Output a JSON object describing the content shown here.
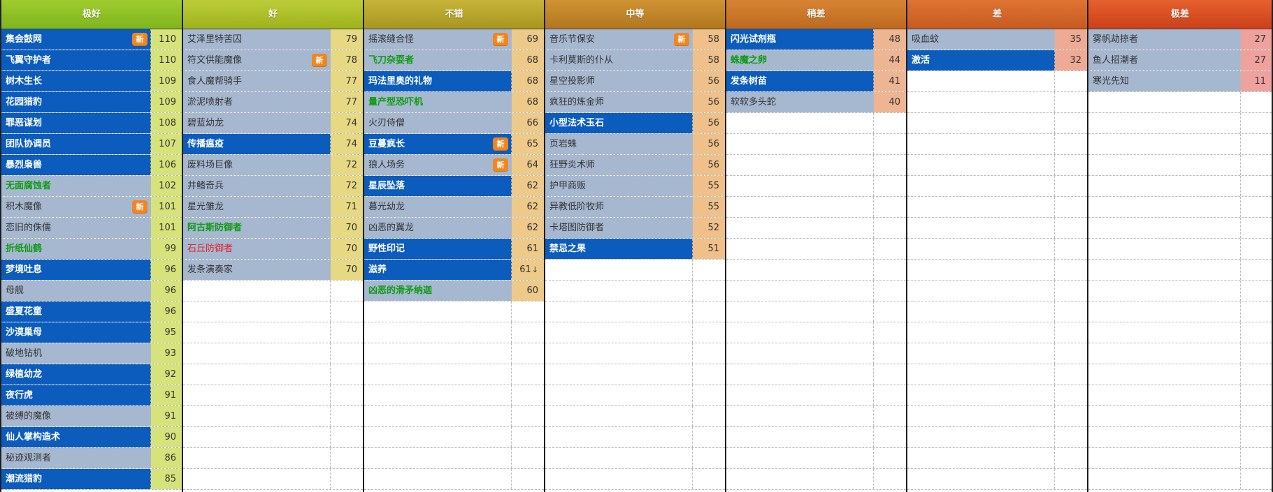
{
  "columns": [
    {
      "title": "极好",
      "header_color": "#7fb51d",
      "header_color_light": "#9fcc2f",
      "score_bg": "#d6e37b",
      "rows": [
        {
          "name": "集会鼓网",
          "score": "110",
          "style": "dark",
          "badge": "新"
        },
        {
          "name": "飞翼守护者",
          "score": "110",
          "style": "dark"
        },
        {
          "name": "树木生长",
          "score": "109",
          "style": "dark"
        },
        {
          "name": "花园猎豹",
          "score": "109",
          "style": "dark"
        },
        {
          "name": "罪恶谋划",
          "score": "108",
          "style": "dark"
        },
        {
          "name": "团队协调员",
          "score": "107",
          "style": "dark"
        },
        {
          "name": "暴烈枭兽",
          "score": "106",
          "style": "dark"
        },
        {
          "name": "无面腐蚀者",
          "score": "102",
          "style": "green"
        },
        {
          "name": "积木魔像",
          "score": "101",
          "style": "light",
          "badge": "新"
        },
        {
          "name": "恋旧的侏儒",
          "score": "101",
          "style": "light"
        },
        {
          "name": "折纸仙鹤",
          "score": "99",
          "style": "green"
        },
        {
          "name": "梦境吐息",
          "score": "96",
          "style": "dark"
        },
        {
          "name": "母舰",
          "score": "96",
          "style": "light"
        },
        {
          "name": "盛夏花童",
          "score": "96",
          "style": "dark"
        },
        {
          "name": "沙漠巢母",
          "score": "95",
          "style": "dark"
        },
        {
          "name": "破地钻机",
          "score": "93",
          "style": "light"
        },
        {
          "name": "绿植幼龙",
          "score": "92",
          "style": "dark"
        },
        {
          "name": "夜行虎",
          "score": "91",
          "style": "dark"
        },
        {
          "name": "被缚的魔像",
          "score": "91",
          "style": "light"
        },
        {
          "name": "仙人掌构造术",
          "score": "90",
          "style": "dark"
        },
        {
          "name": "秘迹观测者",
          "score": "86",
          "style": "light"
        },
        {
          "name": "潮流猎豹",
          "score": "85",
          "style": "dark"
        }
      ]
    },
    {
      "title": "好",
      "header_color": "#9eb21c",
      "header_color_light": "#bccd38",
      "score_bg": "#e7d983",
      "rows": [
        {
          "name": "艾泽里特苦囚",
          "score": "79",
          "style": "light"
        },
        {
          "name": "符文供能魔像",
          "score": "78",
          "style": "light",
          "badge": "新"
        },
        {
          "name": "食人魔帮骑手",
          "score": "77",
          "style": "light"
        },
        {
          "name": "淤泥喷射者",
          "score": "77",
          "style": "light"
        },
        {
          "name": "碧蓝幼龙",
          "score": "74",
          "style": "light"
        },
        {
          "name": "传播瘟疫",
          "score": "74",
          "style": "dark"
        },
        {
          "name": "废料场巨像",
          "score": "72",
          "style": "light"
        },
        {
          "name": "井鳍奇兵",
          "score": "72",
          "style": "light"
        },
        {
          "name": "星光雏龙",
          "score": "71",
          "style": "light"
        },
        {
          "name": "阿古斯防御者",
          "score": "70",
          "style": "green"
        },
        {
          "name": "石丘防御者",
          "score": "70",
          "style": "red"
        },
        {
          "name": "发条演奏家",
          "score": "70",
          "style": "light"
        }
      ]
    },
    {
      "title": "不错",
      "header_color": "#a8961f",
      "header_color_light": "#c6b43a",
      "score_bg": "#edc98a",
      "rows": [
        {
          "name": "摇滚缝合怪",
          "score": "69",
          "style": "light",
          "badge": "新"
        },
        {
          "name": "飞刀杂耍者",
          "score": "68",
          "style": "green"
        },
        {
          "name": "玛法里奥的礼物",
          "score": "68",
          "style": "dark"
        },
        {
          "name": "量产型恐吓机",
          "score": "68",
          "style": "green"
        },
        {
          "name": "火刃侍僧",
          "score": "66",
          "style": "light"
        },
        {
          "name": "豆蔓疯长",
          "score": "65",
          "style": "dark",
          "badge": "新"
        },
        {
          "name": "狼人场务",
          "score": "64",
          "style": "light",
          "badge": "新"
        },
        {
          "name": "星辰坠落",
          "score": "62",
          "style": "dark"
        },
        {
          "name": "暮光幼龙",
          "score": "62",
          "style": "light"
        },
        {
          "name": "凶恶的翼龙",
          "score": "62",
          "style": "light"
        },
        {
          "name": "野性印记",
          "score": "61",
          "style": "dark"
        },
        {
          "name": "滋养",
          "score": "61",
          "style": "dark",
          "arrow": "↓"
        },
        {
          "name": "凶恶的滑矛纳迦",
          "score": "60",
          "style": "green"
        }
      ]
    },
    {
      "title": "中等",
      "header_color": "#b2771e",
      "header_color_light": "#cf9333",
      "score_bg": "#efc08a",
      "rows": [
        {
          "name": "音乐节保安",
          "score": "58",
          "style": "light",
          "badge": "新"
        },
        {
          "name": "卡利莫斯的仆从",
          "score": "58",
          "style": "light"
        },
        {
          "name": "星空投影师",
          "score": "56",
          "style": "light"
        },
        {
          "name": "疯狂的炼金师",
          "score": "56",
          "style": "light"
        },
        {
          "name": "小型法术玉石",
          "score": "56",
          "style": "dark"
        },
        {
          "name": "页岩蛛",
          "score": "56",
          "style": "light"
        },
        {
          "name": "狂野炎术师",
          "score": "56",
          "style": "light"
        },
        {
          "name": "护甲商贩",
          "score": "55",
          "style": "light"
        },
        {
          "name": "异教低阶牧师",
          "score": "55",
          "style": "light"
        },
        {
          "name": "卡塔图防御者",
          "score": "52",
          "style": "light"
        },
        {
          "name": "禁忌之果",
          "score": "51",
          "style": "dark"
        }
      ]
    },
    {
      "title": "稍差",
      "header_color": "#bd6a1f",
      "header_color_light": "#d78434",
      "score_bg": "#edb592",
      "rows": [
        {
          "name": "闪光试剂瓶",
          "score": "48",
          "style": "dark"
        },
        {
          "name": "蛛魔之卵",
          "score": "44",
          "style": "green"
        },
        {
          "name": "发条树苗",
          "score": "41",
          "style": "dark"
        },
        {
          "name": "软软多头蛇",
          "score": "40",
          "style": "light"
        }
      ]
    },
    {
      "title": "差",
      "header_color": "#c75a1f",
      "header_color_light": "#e07433",
      "score_bg": "#eeaa94",
      "rows": [
        {
          "name": "吸血蚊",
          "score": "35",
          "style": "light"
        },
        {
          "name": "激活",
          "score": "32",
          "style": "dark"
        }
      ]
    },
    {
      "title": "极差",
      "header_color": "#cc4019",
      "header_color_light": "#e6602f",
      "score_bg": "#eea19d",
      "rows": [
        {
          "name": "雾帆劫掠者",
          "score": "27",
          "style": "light"
        },
        {
          "name": "鱼人招潮者",
          "score": "27",
          "style": "light"
        },
        {
          "name": "寒光先知",
          "score": "11",
          "style": "light"
        }
      ]
    }
  ]
}
